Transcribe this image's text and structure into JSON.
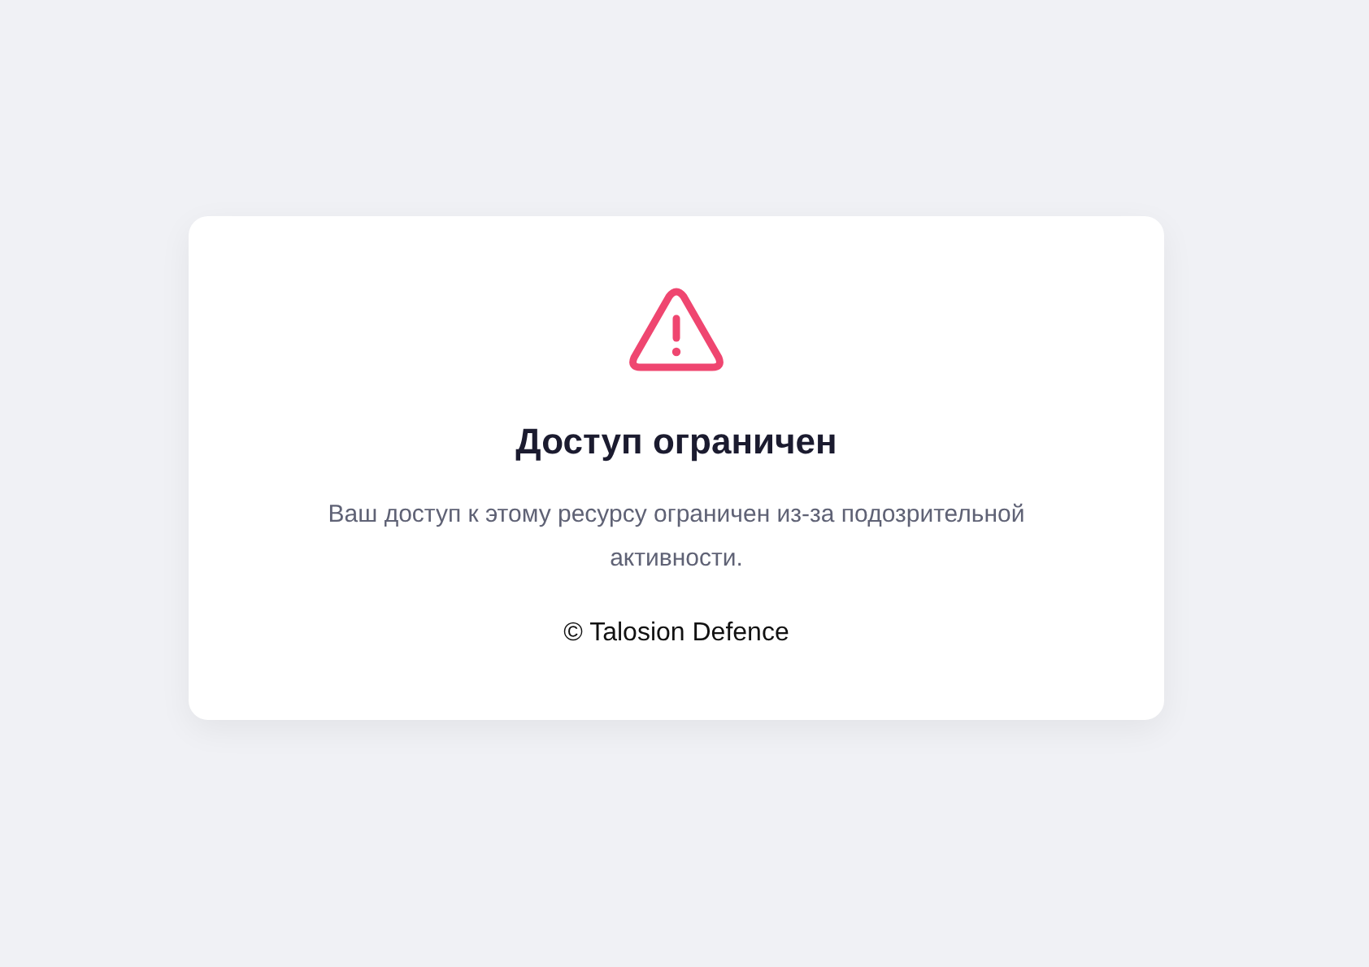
{
  "card": {
    "title": "Доступ ограничен",
    "message": "Ваш доступ к этому ресурсу ограничен из-за подозрительной активности.",
    "footer": "© Talosion Defence"
  }
}
